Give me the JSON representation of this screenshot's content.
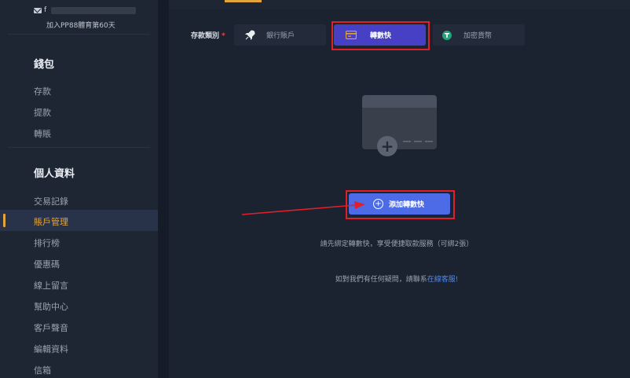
{
  "sidebar": {
    "user_initial": "f",
    "member_text": "加入PP88體育第60天",
    "wallet_heading": "錢包",
    "wallet_items": [
      {
        "label": "存款"
      },
      {
        "label": "提款"
      },
      {
        "label": "轉賬"
      }
    ],
    "profile_heading": "個人資料",
    "profile_items": [
      {
        "label": "交易記錄"
      },
      {
        "label": "賬戶管理"
      },
      {
        "label": "排行榜"
      },
      {
        "label": "優惠碼"
      },
      {
        "label": "線上留言"
      },
      {
        "label": "幫助中心"
      },
      {
        "label": "客戶聲音"
      },
      {
        "label": "編輯資料"
      },
      {
        "label": "信箱"
      }
    ],
    "active_item": "賬戶管理"
  },
  "main": {
    "category_label": "存款類別",
    "required_mark": "*",
    "options": [
      {
        "label": "銀行賬戶",
        "icon": "rocket-icon"
      },
      {
        "label": "轉數快",
        "icon": "card-icon",
        "selected": true
      },
      {
        "label": "加密貨幣",
        "icon": "tether-icon"
      }
    ],
    "add_button_label": "添加轉數快",
    "hint_text": "請先綁定轉數快，享受便捷取款服務（可綁2張）",
    "contact_text": "如對我們有任何疑問，請聯系",
    "contact_link": "在線客服!"
  },
  "colors": {
    "accent_gold": "#e3a53b",
    "selected_purple": "#4840c4",
    "button_blue": "#4d6be6",
    "highlight_red": "#e01f2b",
    "link_blue": "#4f8af0"
  }
}
